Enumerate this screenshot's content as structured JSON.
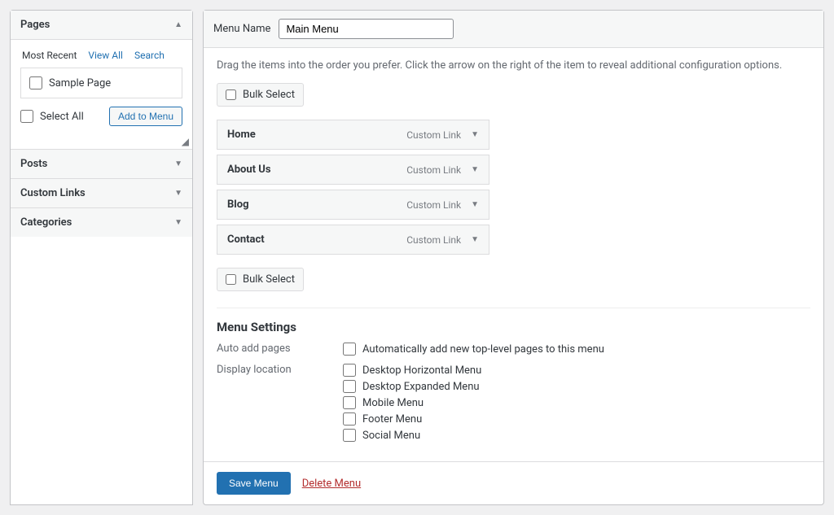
{
  "sidebar": {
    "panels": {
      "pages": {
        "title": "Pages",
        "expanded": true
      },
      "posts": {
        "title": "Posts"
      },
      "custom_links": {
        "title": "Custom Links"
      },
      "categories": {
        "title": "Categories"
      }
    },
    "tabs": {
      "recent": "Most Recent",
      "view_all": "View All",
      "search": "Search"
    },
    "items": {
      "sample_page": "Sample Page"
    },
    "select_all": "Select All",
    "add_to_menu": "Add to Menu"
  },
  "menu": {
    "name_label": "Menu Name",
    "name_value": "Main Menu",
    "instructions": "Drag the items into the order you prefer. Click the arrow on the right of the item to reveal additional configuration options.",
    "bulk_select": "Bulk Select",
    "items": [
      {
        "label": "Home",
        "type": "Custom Link"
      },
      {
        "label": "About Us",
        "type": "Custom Link"
      },
      {
        "label": "Blog",
        "type": "Custom Link"
      },
      {
        "label": "Contact",
        "type": "Custom Link"
      }
    ]
  },
  "settings": {
    "heading": "Menu Settings",
    "auto_add_label": "Auto add pages",
    "auto_add_option": "Automatically add new top-level pages to this menu",
    "display_label": "Display location",
    "locations": [
      "Desktop Horizontal Menu",
      "Desktop Expanded Menu",
      "Mobile Menu",
      "Footer Menu",
      "Social Menu"
    ]
  },
  "footer": {
    "save": "Save Menu",
    "delete": "Delete Menu"
  }
}
